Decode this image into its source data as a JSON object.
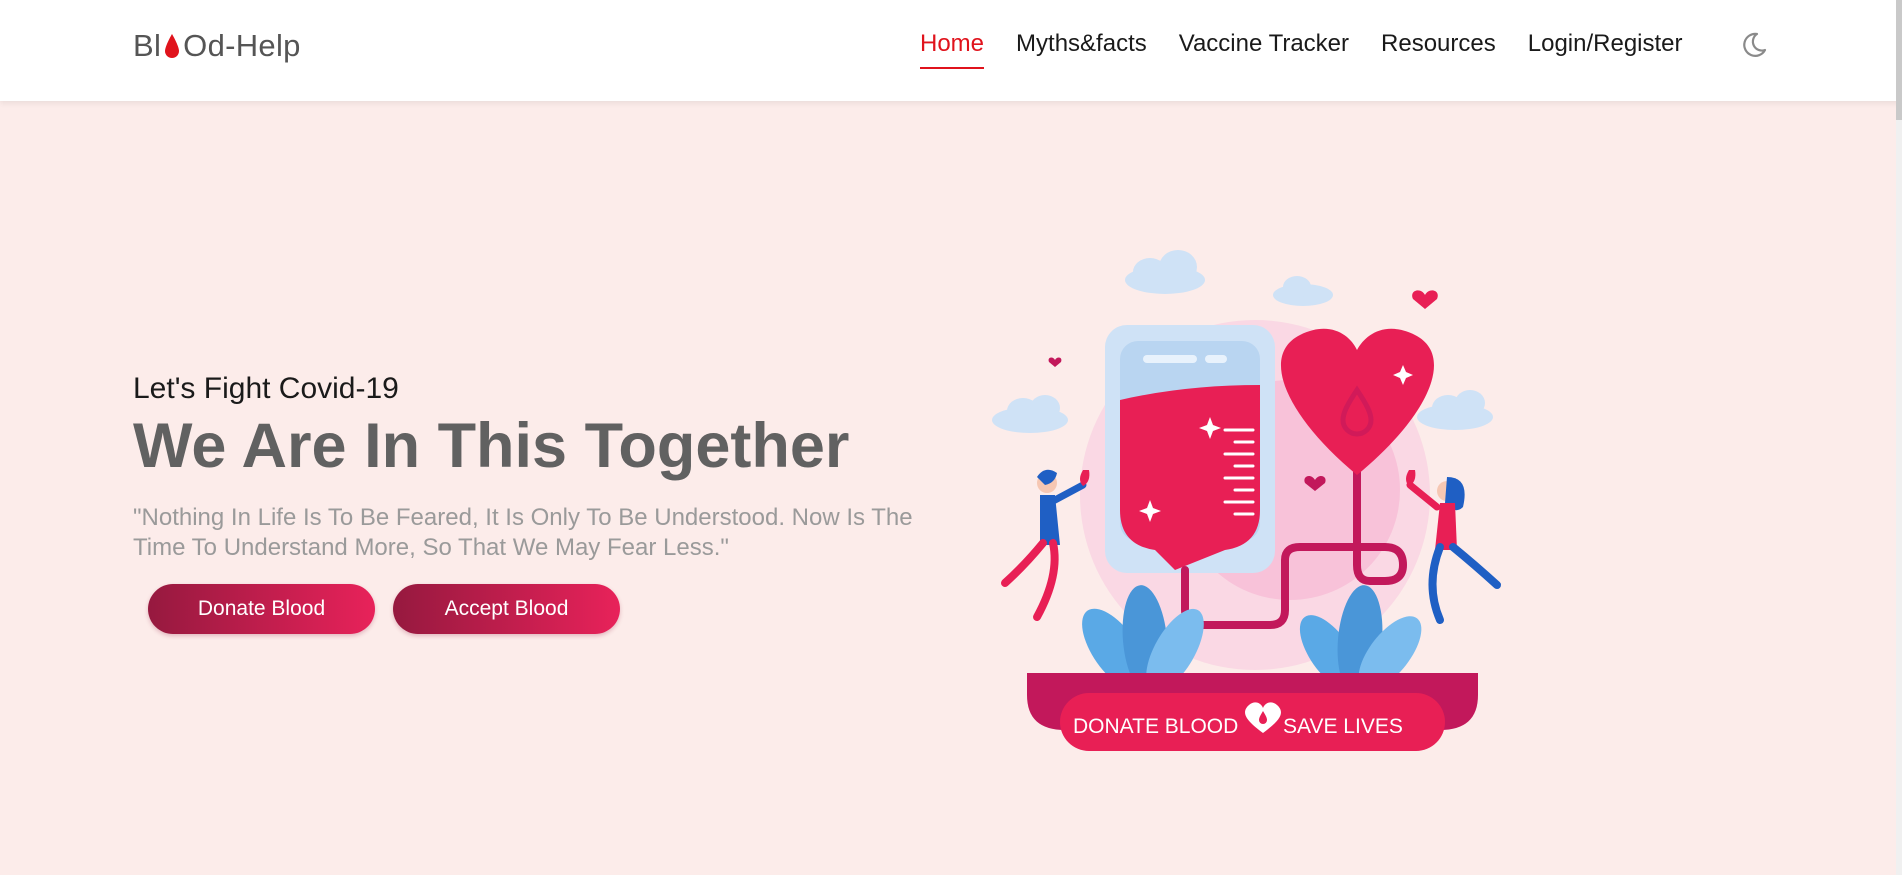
{
  "logo": {
    "prefix": "Bl",
    "suffix": "Od-Help",
    "icon": "blood-drop-icon"
  },
  "nav": {
    "items": [
      {
        "label": "Home",
        "active": true
      },
      {
        "label": "Myths&facts",
        "active": false
      },
      {
        "label": "Vaccine Tracker",
        "active": false
      },
      {
        "label": "Resources",
        "active": false
      },
      {
        "label": "Login/Register",
        "active": false
      }
    ],
    "theme_toggle_icon": "moon-icon"
  },
  "hero": {
    "tagline": "Let's Fight Covid-19",
    "headline": "We Are In This Together",
    "quote": "\"Nothing In Life Is To Be Feared, It Is Only To Be Understood. Now Is The Time To Understand More, So That We May Fear Less.\"",
    "buttons": {
      "donate": "Donate Blood",
      "accept": "Accept Blood"
    }
  },
  "illustration": {
    "banner_left": "DONATE BLOOD",
    "banner_right": "SAVE LIVES"
  },
  "colors": {
    "accent": "#e0131c",
    "page_background": "#fcecea",
    "button_start": "#96193f",
    "button_end": "#e8225a"
  }
}
